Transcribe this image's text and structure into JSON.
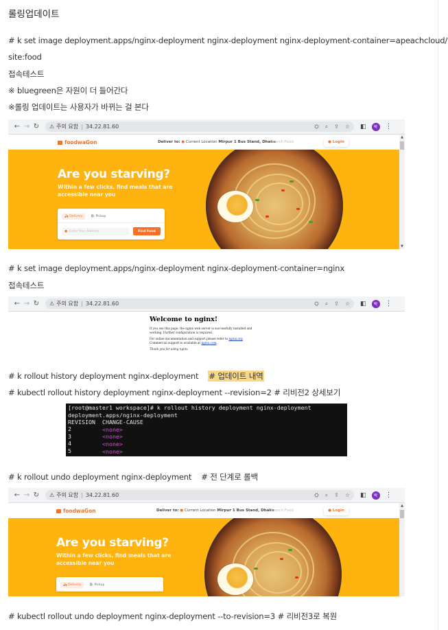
{
  "heading": "롤링업데이트",
  "lines": {
    "set_image_food_1": "# k set image deployment.apps/nginx-deployment nginx-deployment nginx-deployment-container=apeachcloud/web-",
    "set_image_food_2": "site:food",
    "connect_test_1": "접속테스트",
    "note_bluegreen": "※ bluegreen은 자원이 더 들어간다",
    "note_rolling": "※롤링 업데이트는 사용자가 바뀌는 걸 본다",
    "set_image_nginx": "# k set image deployment.apps/nginx-deployment nginx-deployment-container=nginx",
    "connect_test_2": "접속테스트",
    "rollout_history": "# k rollout history deployment nginx-deployment",
    "rollout_history_comment": "# 업데이트 내역",
    "rollout_history_rev": "# kubectl rollout history deployment nginx-deployment --revision=2 # 리비전2 상세보기",
    "rollout_undo": "# k rollout undo deployment nginx-deployment",
    "rollout_undo_comment": "# 전 단계로 롤백",
    "rollout_undo_rev": "# kubectl rollout undo deployment nginx-deployment --to-revision=3  # 리비전3로 복원"
  },
  "browser": {
    "security_label": "주의 요함",
    "url": "34.22.81.60",
    "avatar_letter": "박"
  },
  "foodwagon": {
    "logo": "foodwaGon",
    "deliver_label": "Deliver to:",
    "location_label": "Current Location",
    "location_value": "Mirpur 1 Bus Stand, Dhaka",
    "search_placeholder": "Search Food",
    "login_label": "Login",
    "hero_title": "Are you starving?",
    "hero_subtitle": "Within a few clicks, find meals that are accessible near you",
    "tab_delivery": "Delivery",
    "tab_pickup": "Pickup",
    "address_placeholder": "Enter Your Address",
    "find_button": "Find Food"
  },
  "nginx_page": {
    "title": "Welcome to nginx!",
    "para1": "If you see this page, the nginx web server is successfully installed and working. Further configuration is required.",
    "para2_prefix": "For online documentation and support please refer to ",
    "para2_link": "nginx.org",
    "para3_prefix": "Commercial support is available at ",
    "para3_link": "nginx.com",
    "thanks": "Thank you for using nginx."
  },
  "terminal": {
    "command": "[root@master1 workspace]# k rollout history deployment nginx-deployment",
    "output_title": "deployment.apps/nginx-deployment",
    "header": "REVISION  CHANGE-CAUSE",
    "rows": [
      {
        "revision": "2",
        "cause": "<none>"
      },
      {
        "revision": "3",
        "cause": "<none>"
      },
      {
        "revision": "4",
        "cause": "<none>"
      },
      {
        "revision": "5",
        "cause": "<none>"
      }
    ]
  }
}
